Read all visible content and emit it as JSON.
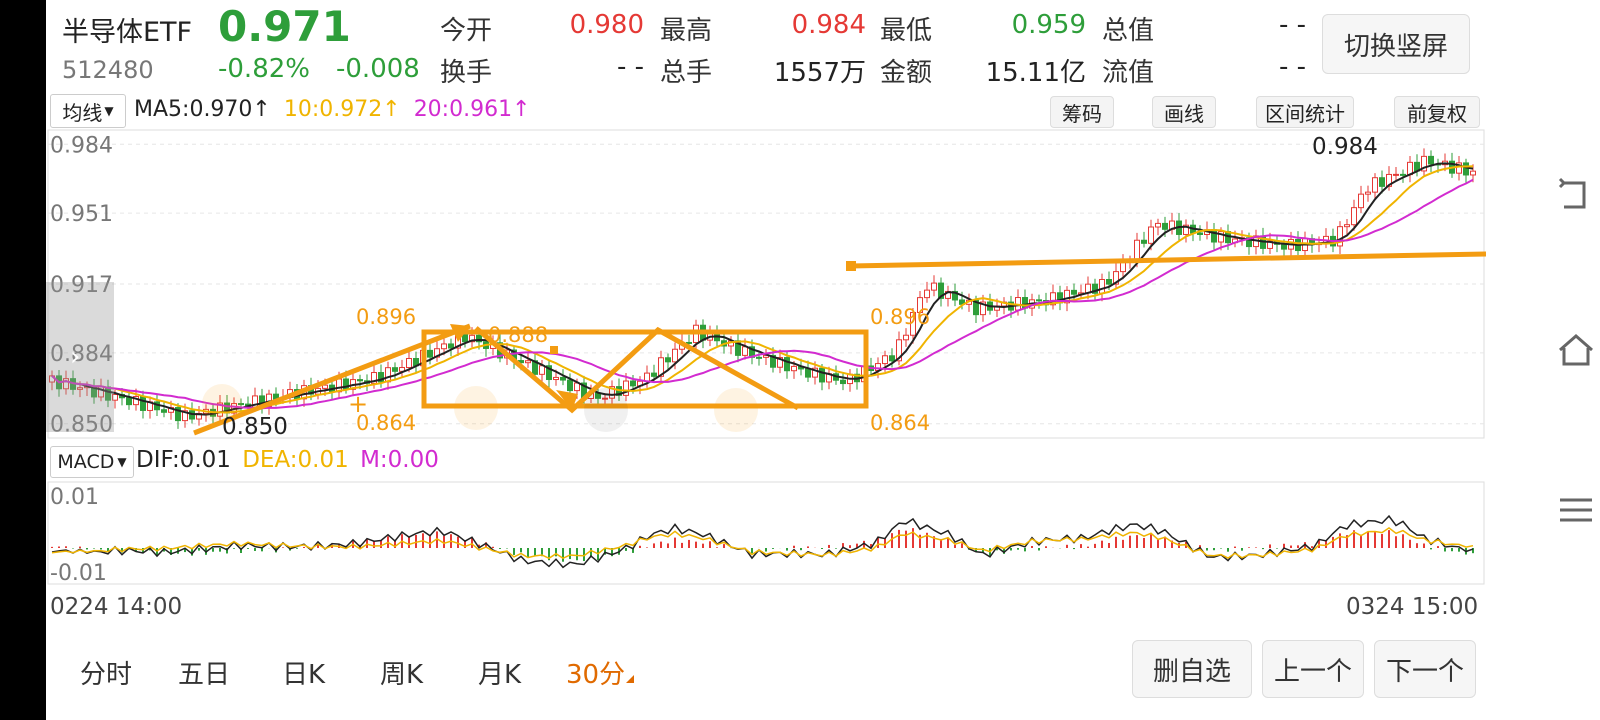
{
  "header": {
    "name": "半导体ETF",
    "price": "0.971",
    "code": "512480",
    "change_pct": "-0.82%",
    "change_abs": "-0.008",
    "stats": [
      {
        "label": "今开",
        "value": "0.980"
      },
      {
        "label": "最高",
        "value": "0.984"
      },
      {
        "label": "最低",
        "value": "0.959"
      },
      {
        "label": "总值",
        "value": "- -"
      },
      {
        "label": "换手",
        "value": "- -"
      },
      {
        "label": "总手",
        "value": "1557万"
      },
      {
        "label": "金额",
        "value": "15.11亿"
      },
      {
        "label": "流值",
        "value": "- -"
      }
    ],
    "rotate_button": "切换竖屏"
  },
  "ma_bar": {
    "selector": "均线",
    "ma5": "MA5:0.970",
    "ma10": "10:0.972",
    "ma20": "20:0.961",
    "arrow": "↑",
    "buttons": [
      "筹码",
      "画线",
      "区间统计",
      "前复权"
    ]
  },
  "price_chart": {
    "y_ticks": [
      "0.984",
      "0.951",
      "0.917",
      "0.884",
      "0.850"
    ],
    "high_label": "0.984",
    "low_label": "0.850",
    "annotations": [
      "0.896",
      "0.864",
      "0.888",
      "0.896",
      "0.864"
    ],
    "colors": {
      "up": "#e53935",
      "down": "#2e9e3a",
      "ma5": "#222222",
      "ma10": "#f0b400",
      "ma20": "#d22bd0",
      "drawing": "#f39c12"
    }
  },
  "macd_bar": {
    "selector": "MACD",
    "dif": "DIF:0.01",
    "dea": "DEA:0.01",
    "m": "M:0.00",
    "y_ticks": [
      "0.01",
      "-0.01"
    ]
  },
  "time_axis": {
    "start": "0224 14:00",
    "end": "0324 15:00"
  },
  "period_tabs": [
    "分时",
    "五日",
    "日K",
    "周K",
    "月K",
    "30分"
  ],
  "active_tab": "30分",
  "bottom_buttons": [
    "删自选",
    "上一个",
    "下一个"
  ]
}
